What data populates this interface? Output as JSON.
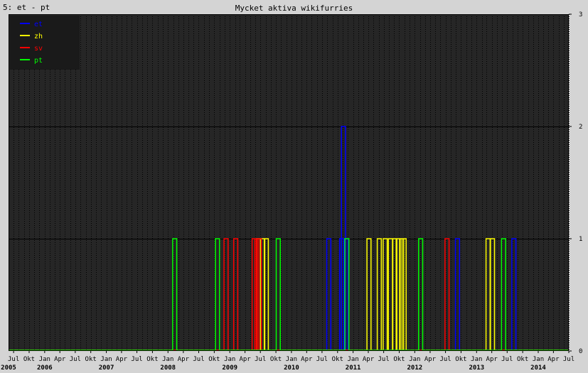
{
  "window": {
    "corner_label": "5: et - pt"
  },
  "chart_data": {
    "type": "line",
    "title": "Mycket aktiva wikifurries",
    "xlabel": "",
    "ylabel": "",
    "xlim": [
      "2005-06-01",
      "2014-07-01"
    ],
    "ylim": [
      0,
      3
    ],
    "y_ticks": [
      0,
      1,
      2,
      3
    ],
    "month_tick_labels": [
      "Jul",
      "Okt",
      "Jan",
      "Apr"
    ],
    "year_labels": [
      "2005",
      "2006",
      "2007",
      "2008",
      "2009",
      "2010",
      "2011",
      "2012",
      "2013",
      "2014"
    ],
    "grid": true,
    "legend_position": "top-left",
    "colors": {
      "background": "#262626",
      "grid_dotted": "#000000",
      "legend_bg": "#1a1a1a"
    },
    "series": [
      {
        "name": "et",
        "color": "#0000ff",
        "spikes": [
          {
            "date": "2010-08-10",
            "value": 1
          },
          {
            "date": "2010-10-25",
            "value": 1
          },
          {
            "date": "2010-11-05",
            "value": 2
          },
          {
            "date": "2010-11-20",
            "value": 1
          },
          {
            "date": "2012-09-10",
            "value": 1
          },
          {
            "date": "2013-08-10",
            "value": 1
          }
        ]
      },
      {
        "name": "zh",
        "color": "#ffff00",
        "spikes": [
          {
            "date": "2009-06-20",
            "value": 1
          },
          {
            "date": "2009-07-15",
            "value": 1
          },
          {
            "date": "2009-08-05",
            "value": 1
          },
          {
            "date": "2011-04-05",
            "value": 1
          },
          {
            "date": "2011-06-05",
            "value": 1
          },
          {
            "date": "2011-07-10",
            "value": 1
          },
          {
            "date": "2011-08-10",
            "value": 1
          },
          {
            "date": "2011-09-05",
            "value": 1
          },
          {
            "date": "2011-09-25",
            "value": 1
          },
          {
            "date": "2011-10-15",
            "value": 1
          },
          {
            "date": "2011-10-30",
            "value": 1
          },
          {
            "date": "2013-03-10",
            "value": 1
          },
          {
            "date": "2013-04-05",
            "value": 1
          }
        ]
      },
      {
        "name": "sv",
        "color": "#ff0000",
        "spikes": [
          {
            "date": "2008-12-10",
            "value": 1
          },
          {
            "date": "2009-02-05",
            "value": 1
          },
          {
            "date": "2009-05-25",
            "value": 1
          },
          {
            "date": "2009-06-10",
            "value": 1
          },
          {
            "date": "2009-06-25",
            "value": 1
          },
          {
            "date": "2012-07-10",
            "value": 1
          }
        ]
      },
      {
        "name": "pt",
        "color": "#00ff00",
        "spikes": [
          {
            "date": "2008-02-10",
            "value": 1
          },
          {
            "date": "2008-10-20",
            "value": 1
          },
          {
            "date": "2009-10-15",
            "value": 1
          },
          {
            "date": "2010-11-25",
            "value": 1
          },
          {
            "date": "2012-02-05",
            "value": 1
          },
          {
            "date": "2013-06-10",
            "value": 1
          }
        ]
      }
    ]
  }
}
